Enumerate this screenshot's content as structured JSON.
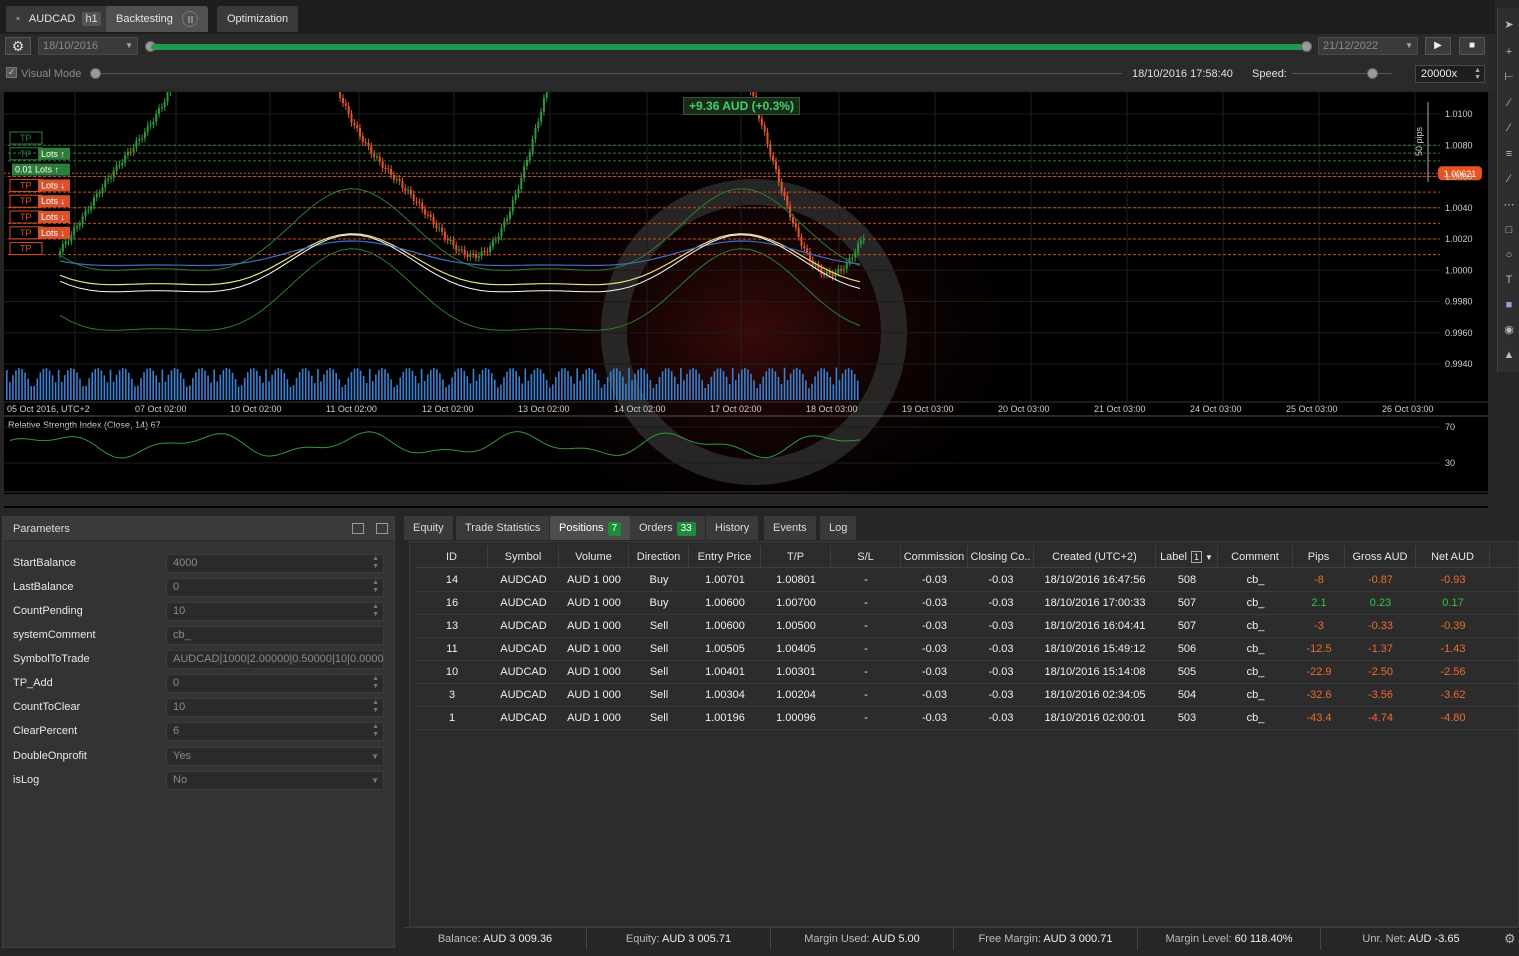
{
  "tabs": {
    "symbol": "AUDCAD",
    "timeframe": "h1",
    "backtesting": "Backtesting",
    "optimization": "Optimization"
  },
  "controls": {
    "start_date": "18/10/2016",
    "end_date": "21/12/2022",
    "progress_fraction": 1.0,
    "visual_mode_label": "Visual Mode",
    "visual_mode_checked": true,
    "current_time": "18/10/2016 17:58:40",
    "speed_label": "Speed:",
    "speed_value": "20000x"
  },
  "chart": {
    "pnl_badge": "+9.36 AUD (+0.3%)",
    "current_price": "1.00621",
    "pips_label": "50 pips",
    "price_ticks": [
      "1.0100",
      "1.0080",
      "1.0060",
      "1.0040",
      "1.0020",
      "1.0000",
      "0.9980",
      "0.9960",
      "0.9940"
    ],
    "time_ticks": [
      "05 Oct 2016, UTC+2",
      "07 Oct 02:00",
      "10 Oct 02:00",
      "11 Oct 02:00",
      "12 Oct 02:00",
      "13 Oct 02:00",
      "14 Oct 02:00",
      "17 Oct 02:00",
      "18 Oct 03:00",
      "19 Oct 03:00",
      "20 Oct 03:00",
      "21 Oct 03:00",
      "24 Oct 03:00",
      "25 Oct 03:00",
      "26 Oct 03:00"
    ],
    "rsi_label": "Relative Strength Index (Close, 14) 67",
    "rsi_ticks": [
      "70",
      "30"
    ],
    "order_tags": [
      {
        "tp": "TP",
        "lots": "",
        "dir": "",
        "color": "#2e7d3a"
      },
      {
        "tp": "TP",
        "lots": "Lots",
        "dir": "up",
        "color": "#2e7d3a"
      },
      {
        "tp": "",
        "lots": "0.01 Lots",
        "dir": "up",
        "color": "#2e7d3a"
      },
      {
        "tp": "TP",
        "lots": "Lots",
        "dir": "down",
        "color": "#d9502a"
      },
      {
        "tp": "TP",
        "lots": "Lots",
        "dir": "down",
        "color": "#d9502a"
      },
      {
        "tp": "TP",
        "lots": "Lots",
        "dir": "down",
        "color": "#d9502a"
      },
      {
        "tp": "TP",
        "lots": "Lots",
        "dir": "down",
        "color": "#d9502a"
      },
      {
        "tp": "TP",
        "lots": "",
        "dir": "",
        "color": "#d9502a"
      }
    ]
  },
  "params": {
    "title": "Parameters",
    "rows": [
      {
        "label": "StartBalance",
        "value": "4000",
        "kind": "spin"
      },
      {
        "label": "LastBalance",
        "value": "0",
        "kind": "spin"
      },
      {
        "label": "CountPending",
        "value": "10",
        "kind": "spin"
      },
      {
        "label": "systemComment",
        "value": "cb_",
        "kind": "text"
      },
      {
        "label": "SymbolToTrade",
        "value": "AUDCAD|1000|2.00000|0.50000|10|0.00006",
        "kind": "text"
      },
      {
        "label": "TP_Add",
        "value": "0",
        "kind": "spin"
      },
      {
        "label": "CountToClear",
        "value": "10",
        "kind": "spin"
      },
      {
        "label": "ClearPercent",
        "value": "6",
        "kind": "spin"
      },
      {
        "label": "DoubleOnprofit",
        "value": "Yes",
        "kind": "select"
      },
      {
        "label": "isLog",
        "value": "No",
        "kind": "select"
      }
    ]
  },
  "bottom_tabs": [
    {
      "label": "Equity",
      "count": ""
    },
    {
      "label": "Trade Statistics",
      "count": ""
    },
    {
      "label": "Positions",
      "count": "7"
    },
    {
      "label": "Orders",
      "count": "33"
    },
    {
      "label": "History",
      "count": ""
    },
    {
      "label": "Events",
      "count": ""
    },
    {
      "label": "Log",
      "count": ""
    }
  ],
  "positions": {
    "columns": [
      "ID",
      "Symbol",
      "Volume",
      "Direction",
      "Entry Price",
      "T/P",
      "S/L",
      "Commission",
      "Closing Co..",
      "Created (UTC+2)",
      "Label",
      "Comment",
      "Pips",
      "Gross AUD",
      "Net AUD"
    ],
    "label_sort_badge": "1",
    "rows": [
      [
        "14",
        "AUDCAD",
        "AUD 1 000",
        "Buy",
        "1.00701",
        "1.00801",
        "-",
        "-0.03",
        "-0.03",
        "18/10/2016 16:47:56",
        "508",
        "cb_",
        "-8",
        "-0.87",
        "-0.93"
      ],
      [
        "16",
        "AUDCAD",
        "AUD 1 000",
        "Buy",
        "1.00600",
        "1.00700",
        "-",
        "-0.03",
        "-0.03",
        "18/10/2016 17:00:33",
        "507",
        "cb_",
        "2.1",
        "0.23",
        "0.17"
      ],
      [
        "13",
        "AUDCAD",
        "AUD 1 000",
        "Sell",
        "1.00600",
        "1.00500",
        "-",
        "-0.03",
        "-0.03",
        "18/10/2016 16:04:41",
        "507",
        "cb_",
        "-3",
        "-0.33",
        "-0.39"
      ],
      [
        "11",
        "AUDCAD",
        "AUD 1 000",
        "Sell",
        "1.00505",
        "1.00405",
        "-",
        "-0.03",
        "-0.03",
        "18/10/2016 15:49:12",
        "506",
        "cb_",
        "-12.5",
        "-1.37",
        "-1.43"
      ],
      [
        "10",
        "AUDCAD",
        "AUD 1 000",
        "Sell",
        "1.00401",
        "1.00301",
        "-",
        "-0.03",
        "-0.03",
        "18/10/2016 15:14:08",
        "505",
        "cb_",
        "-22.9",
        "-2.50",
        "-2.56"
      ],
      [
        "3",
        "AUDCAD",
        "AUD 1 000",
        "Sell",
        "1.00304",
        "1.00204",
        "-",
        "-0.03",
        "-0.03",
        "18/10/2016 02:34:05",
        "504",
        "cb_",
        "-32.6",
        "-3.56",
        "-3.62"
      ],
      [
        "1",
        "AUDCAD",
        "AUD 1 000",
        "Sell",
        "1.00196",
        "1.00096",
        "-",
        "-0.03",
        "-0.03",
        "18/10/2016 02:00:01",
        "503",
        "cb_",
        "-43.4",
        "-4.74",
        "-4.80"
      ]
    ]
  },
  "status": {
    "balance_label": "Balance:",
    "balance": "AUD 3 009.36",
    "equity_label": "Equity:",
    "equity": "AUD 3 005.71",
    "margin_used_label": "Margin Used:",
    "margin_used": "AUD 5.00",
    "free_margin_label": "Free Margin:",
    "free_margin": "AUD 3 000.71",
    "margin_level_label": "Margin Level:",
    "margin_level": "60 118.40%",
    "unr_net_label": "Unr. Net:",
    "unr_net": "AUD -3.65"
  },
  "colors": {
    "accent_green": "#1f9a4a",
    "loss": "#ef6b2e",
    "profit": "#39c14d",
    "price_marker": "#e8541f"
  }
}
